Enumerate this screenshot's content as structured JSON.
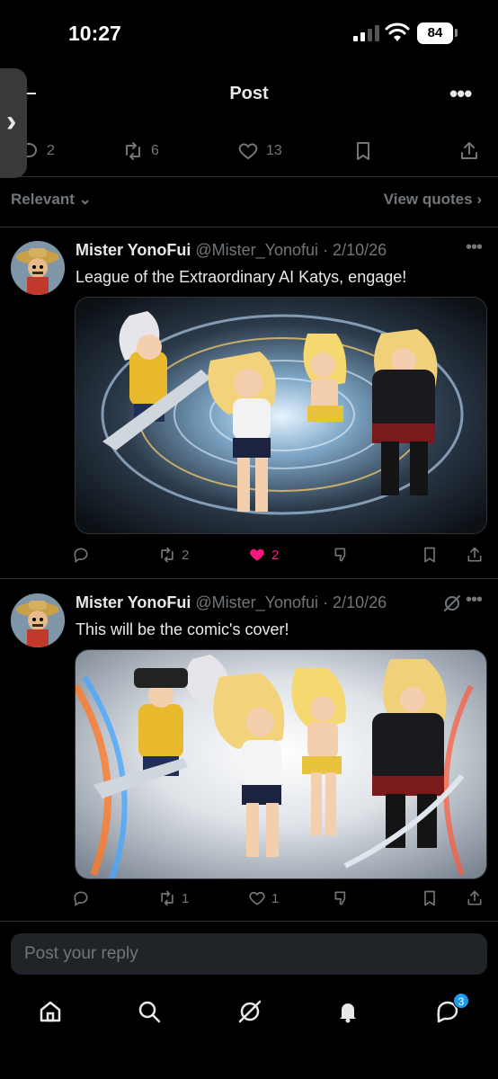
{
  "status": {
    "time": "10:27",
    "battery": "84"
  },
  "header": {
    "title": "Post"
  },
  "stats": {
    "replies": "2",
    "reposts": "6",
    "likes": "13"
  },
  "sort": {
    "relevant_label": "Relevant",
    "view_quotes_label": "View quotes"
  },
  "replies": [
    {
      "name": "Mister YonoFui",
      "handle": "@Mister_Yonofui",
      "date": "· 2/10/26",
      "text": "League of the Extraordinary AI Katys, engage!",
      "replies": "",
      "reposts": "2",
      "likes": "2",
      "liked": true,
      "media": "Anime illustration: five heroines in a swirling vortex wielding giant scissors and swords"
    },
    {
      "name": "Mister YonoFui",
      "handle": "@Mister_Yonofui",
      "date": "· 2/10/26",
      "text": "This will be the comic's cover!",
      "replies": "",
      "reposts": "1",
      "likes": "1",
      "liked": false,
      "media": "Anime comic cover: five heroines leaping forward with blades and light trails"
    }
  ],
  "reply_box": {
    "placeholder": "Post your reply"
  },
  "nav": {
    "messages_badge": "3"
  },
  "colors": {
    "background": "#000000",
    "text": "#e7e9ea",
    "muted": "#71767b",
    "like": "#f91880",
    "accent": "#1d9bf0",
    "divider": "#2f3336"
  }
}
